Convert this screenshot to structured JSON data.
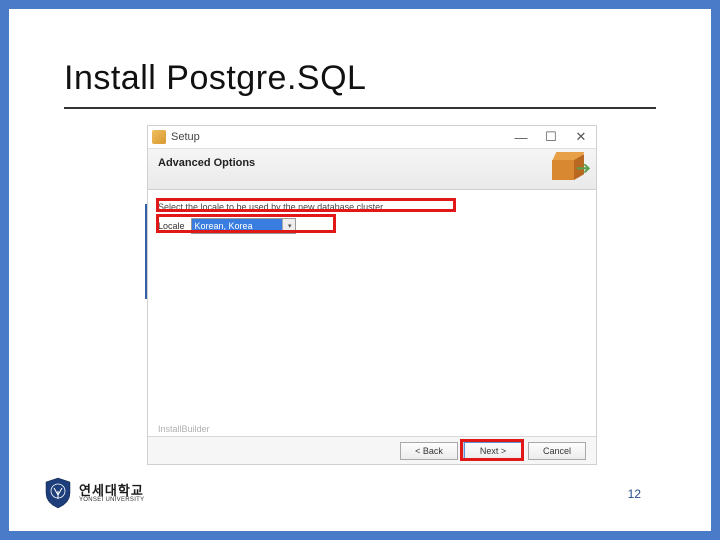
{
  "slide": {
    "title": "Install Postgre.SQL",
    "page_number": "12"
  },
  "university": {
    "name_kr": "연세대학교",
    "name_en": "YONSEI UNIVERSITY",
    "shield_color": "#1d3e7a"
  },
  "installer": {
    "window_title": "Setup",
    "header": "Advanced Options",
    "instruction": "Select the locale to be used by the new database cluster.",
    "locale_label": "Locale",
    "locale_value": "Korean, Korea",
    "install_builder": "InstallBuilder",
    "buttons": {
      "back": "< Back",
      "next": "Next >",
      "cancel": "Cancel"
    },
    "window_controls": {
      "minimize": "—",
      "maximize": "☐",
      "close": "✕"
    }
  }
}
